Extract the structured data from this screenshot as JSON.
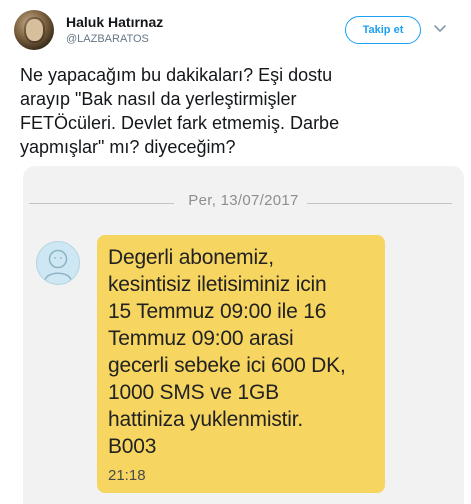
{
  "tweet": {
    "author": {
      "display_name": "Haluk Hatırnaz",
      "handle": "@LAZBARATOS"
    },
    "follow_label": "Takip et",
    "text": "Ne yapacağım  bu dakikaları? Eşi dostu\narayıp \"Bak nasıl da yerleştirmişler\nFETÖcüleri. Devlet fark etmemiş. Darbe\nyapmışlar\" mı? diyeceğim?",
    "accent_color": "#1da1f2",
    "icons": {
      "menu": "chevron-down-icon"
    }
  },
  "image": {
    "date": "Per, 13/07/2017",
    "message": {
      "text": "Degerli abonemiz,\nkesintisiz iletisiminiz icin\n15 Temmuz 09:00 ile 16\nTemmuz 09:00 arasi\ngecerli sebeke ici 600 DK,\n1000 SMS ve 1GB\nhattiniza yuklenmistir.\nB003",
      "time": "21:18",
      "bubble_color": "#f6d560"
    },
    "contact_icon": "person-icon"
  }
}
